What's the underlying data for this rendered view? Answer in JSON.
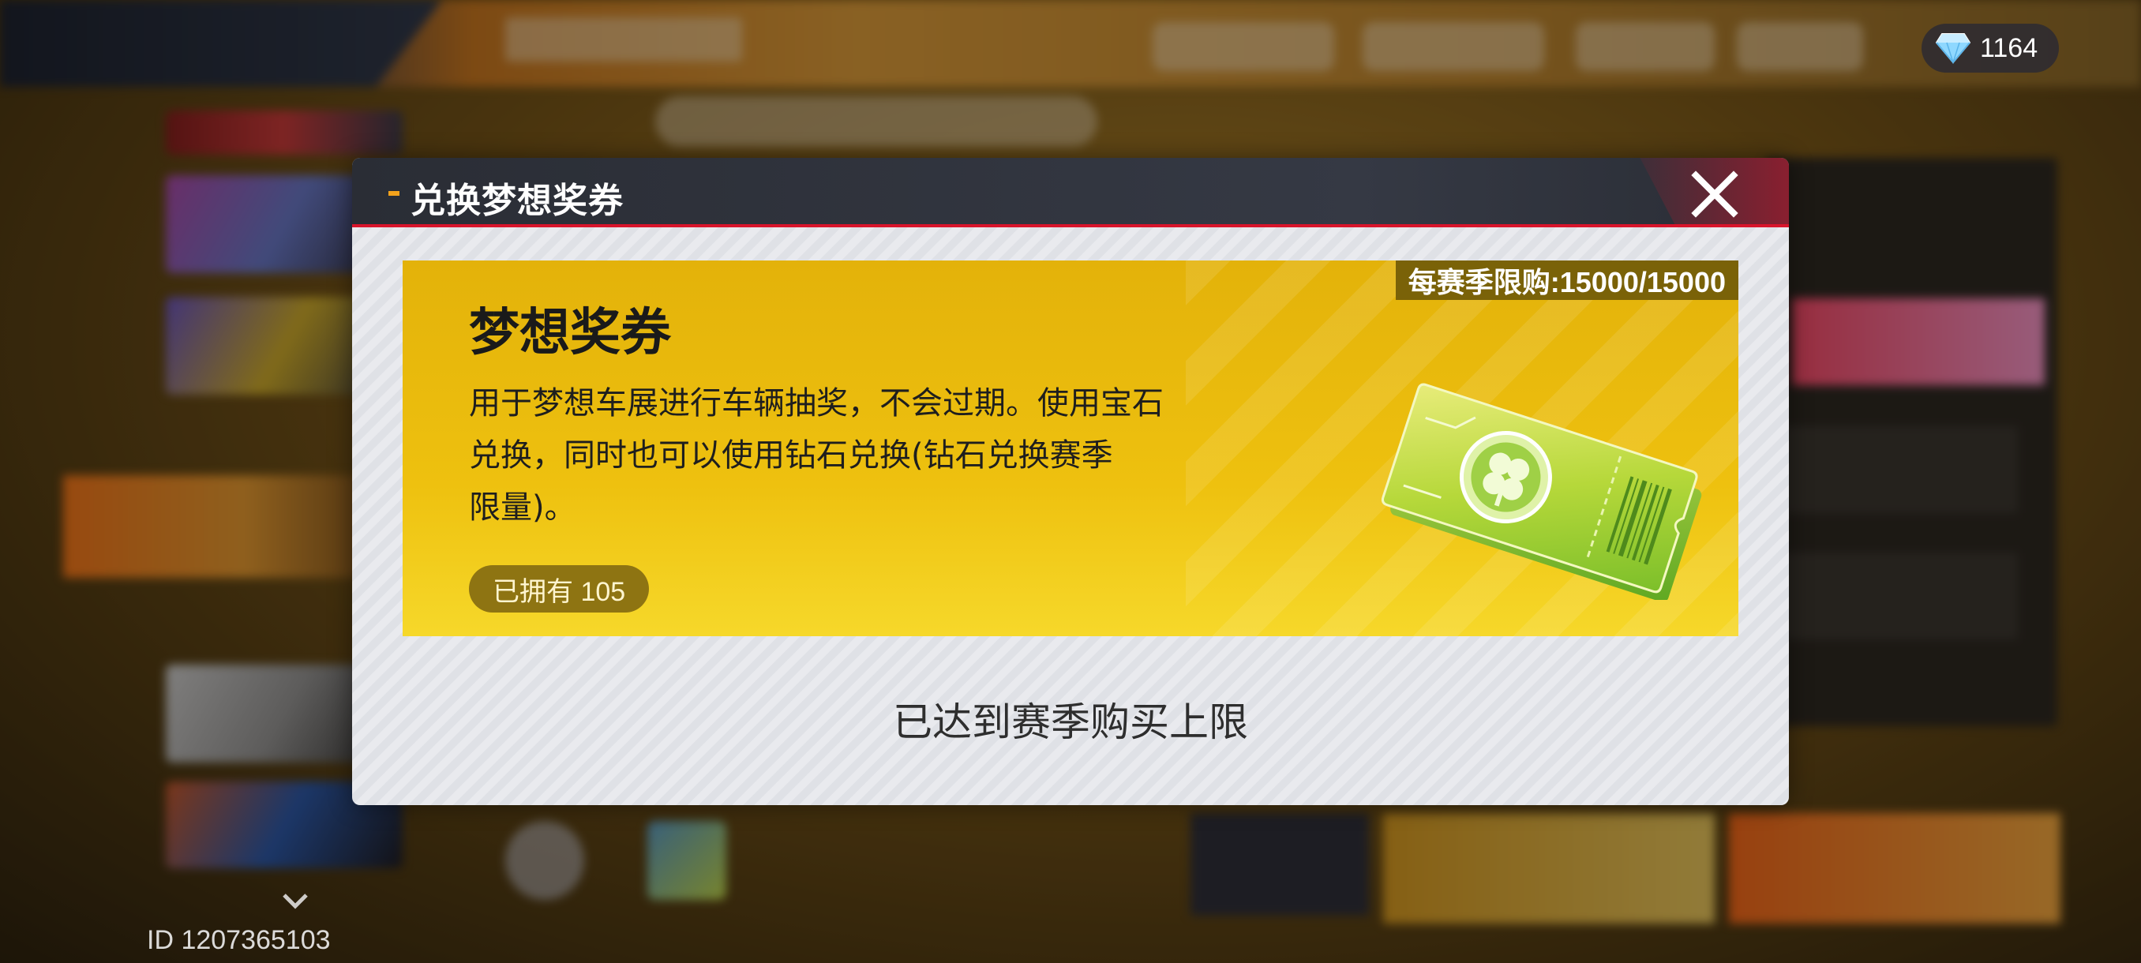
{
  "top_bar": {
    "currency": {
      "icon": "diamond-icon",
      "value": "1164"
    }
  },
  "dialog": {
    "title": "兑换梦想奖券",
    "close_icon": "close-icon",
    "item": {
      "name": "梦想奖券",
      "purchase_limit": "每赛季限购:15000/15000",
      "description_lines": [
        "用于梦想车展进行车辆抽奖，不会过期。使用宝石",
        "兑换，同时也可以使用钻石兑换(钻石兑换赛季",
        "限量)。"
      ],
      "owned": "已拥有 105",
      "image_icon": "clover-ticket-icon"
    },
    "status": "已达到赛季购买上限"
  },
  "footer": {
    "player_id": "ID 1207365103"
  },
  "colors": {
    "card_yellow": "#eec10f",
    "accent_red": "#d8142b",
    "header_dark": "#2a2d35",
    "badge_brown": "#8e7412"
  }
}
